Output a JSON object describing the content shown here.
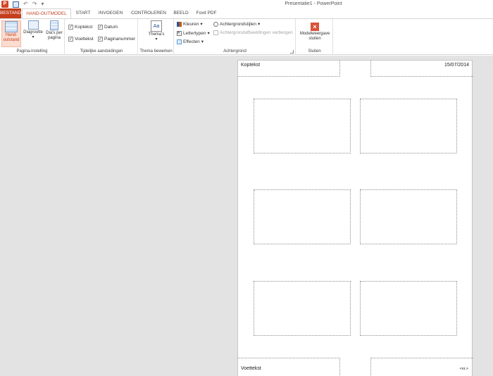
{
  "titlebar": {
    "app_icon": "P",
    "title": "Presentatie1 - PowerPoint",
    "qat": {
      "undo": "↶",
      "redo": "↷",
      "custom": "▾"
    }
  },
  "tabs": {
    "file": "BESTAND",
    "handout": "HAND-OUTMODEL",
    "start": "START",
    "insert": "INVOEGEN",
    "review": "CONTROLEREN",
    "view": "BEELD",
    "foxit": "Foxit PDF"
  },
  "ribbon": {
    "page_setup": {
      "label": "Pagina-instelling",
      "handout_orientation": "Hand-\noutstand",
      "handout_arrow": "▾",
      "slide_size": "Diagrootte",
      "slides_per_page": "Dia's per pagina"
    },
    "placeholders": {
      "label": "Tijdelijke aanduidingen",
      "header": "Koptekst",
      "date": "Datum",
      "footer": "Voettekst",
      "page_number": "Paginanummer"
    },
    "theme": {
      "label": "Thema bewerken",
      "themes": "Thema's",
      "themes_icon": "Aa"
    },
    "background": {
      "label": "Achtergrond",
      "colors": "Kleuren",
      "fonts": "Lettertypen",
      "effects": "Effecten",
      "bg_styles": "Achtergrondstijlen",
      "hide_bg": "Achtergrondafbeeldingen verbergen"
    },
    "close": {
      "label": "Sluiten",
      "close_view": "Modelweergave sluiten",
      "close_icon": "×"
    }
  },
  "page": {
    "header_text": "Koptekst",
    "date_text": "15/07/2014",
    "footer_text": "Voettekst",
    "page_number_text": "<nr.>"
  }
}
